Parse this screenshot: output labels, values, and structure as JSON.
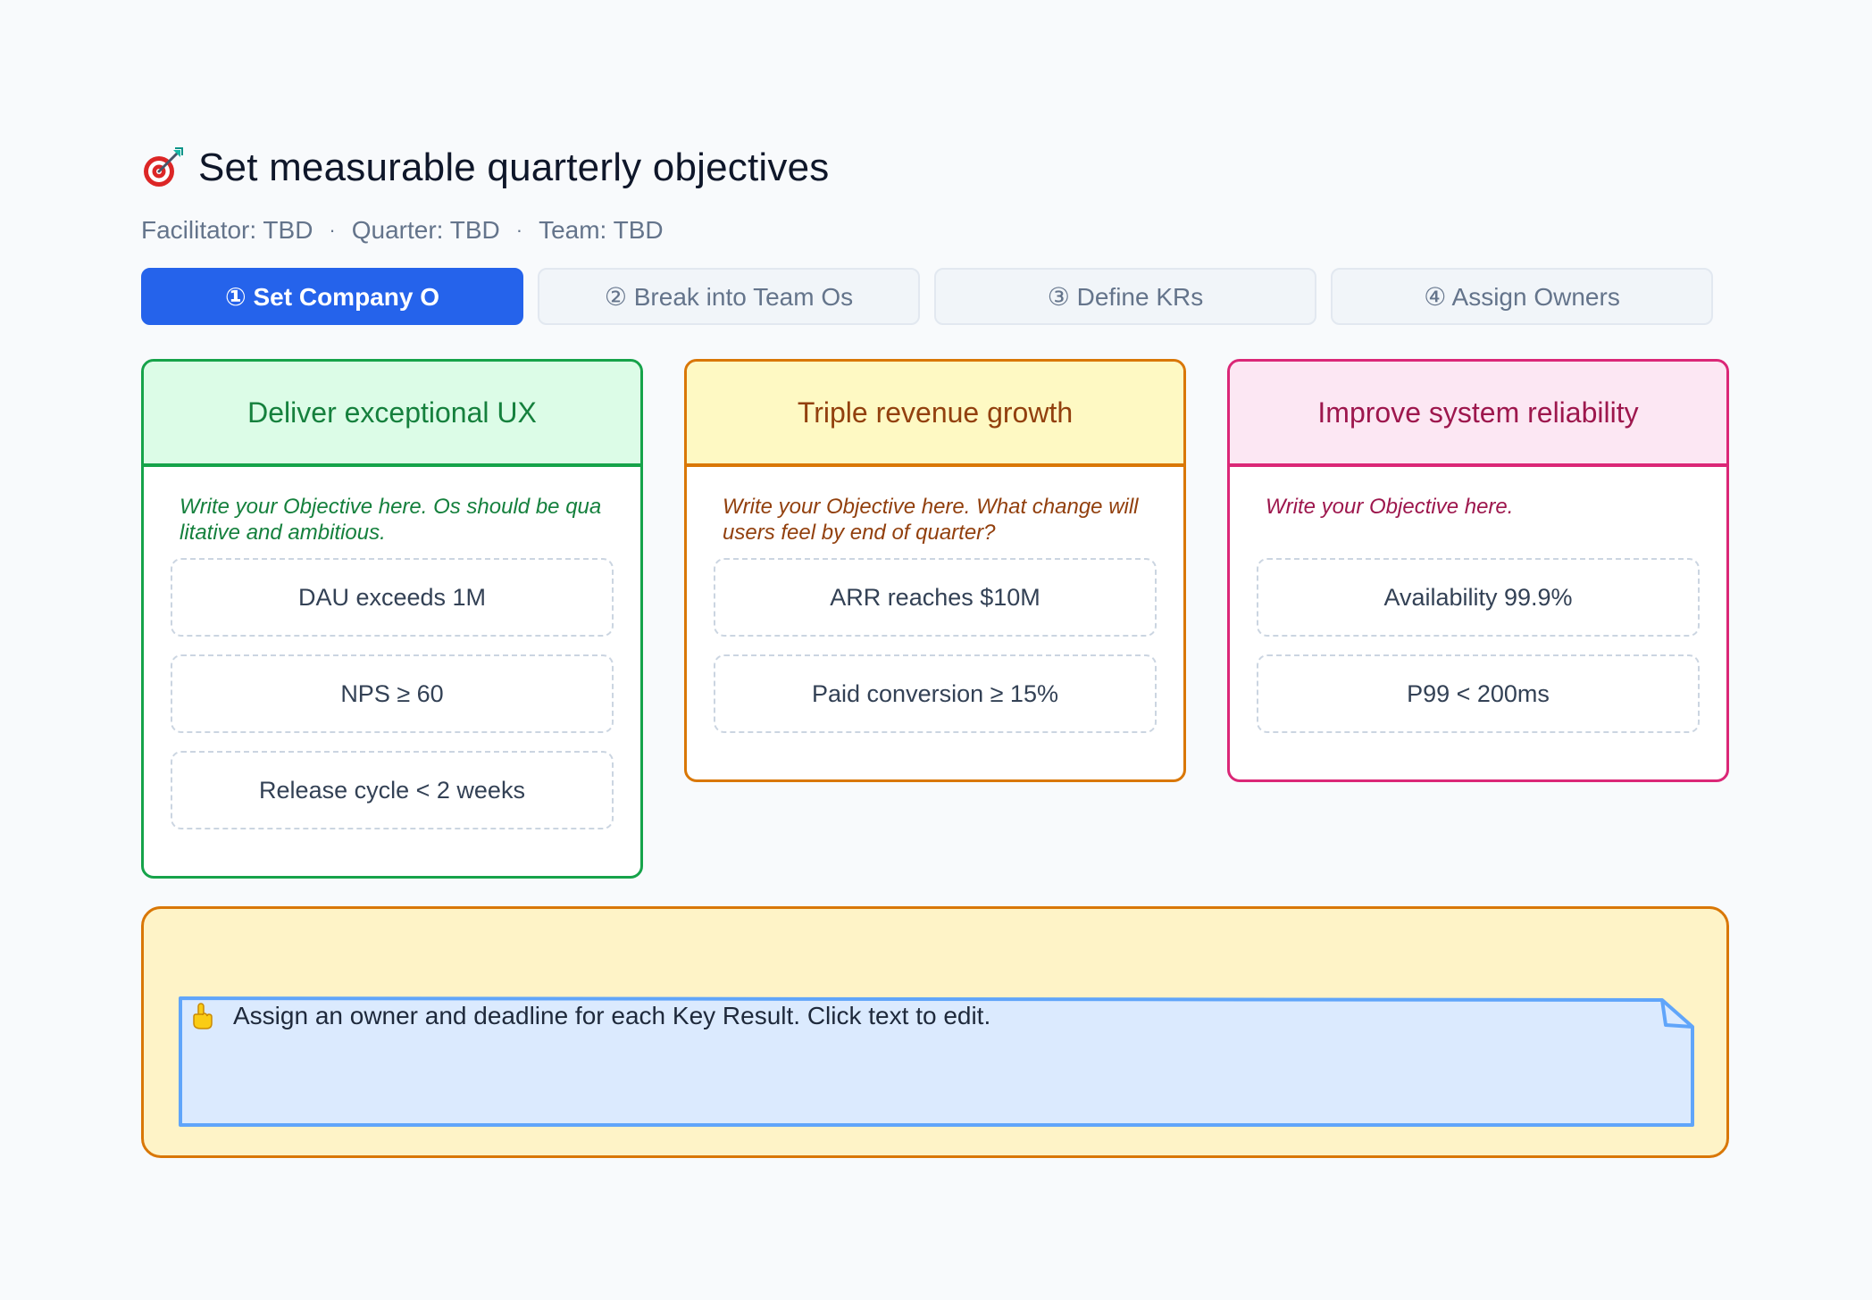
{
  "header": {
    "title_icon": "target-icon",
    "title": "Set measurable quarterly objectives",
    "facilitator": "Facilitator: TBD",
    "quarter": "Quarter: TBD",
    "team": "Team: TBD",
    "separator": "·"
  },
  "steps": [
    {
      "label": "① Set Company O",
      "active": true
    },
    {
      "label": "② Break into Team Os",
      "active": false
    },
    {
      "label": "③ Define KRs",
      "active": false
    },
    {
      "label": "④ Assign Owners",
      "active": false
    }
  ],
  "objectives": [
    {
      "title": "Deliver exceptional UX",
      "description": "Write your Objective here. Os should be qualitative and ambitious.",
      "color": "#16a34a",
      "key_results": [
        "DAU exceeds 1M",
        "NPS ≥ 60",
        "Release cycle < 2 weeks"
      ]
    },
    {
      "title": "Triple revenue growth",
      "description": "Write your Objective here. What change will users feel by end of quarter?",
      "color": "#d97706",
      "key_results": [
        "ARR reaches $10M",
        "Paid conversion ≥ 15%"
      ]
    },
    {
      "title": "Improve system reliability",
      "description": "Write your Objective here.",
      "color": "#db2777",
      "key_results": [
        "Availability 99.9%",
        "P99 < 200ms"
      ]
    }
  ],
  "footer": {
    "note_icon": "pointing-hand-icon",
    "note_text": "Assign an owner and deadline for each Key Result. Click text to edit.",
    "background": "#fef3c7",
    "note_color": "#dbeafe"
  }
}
